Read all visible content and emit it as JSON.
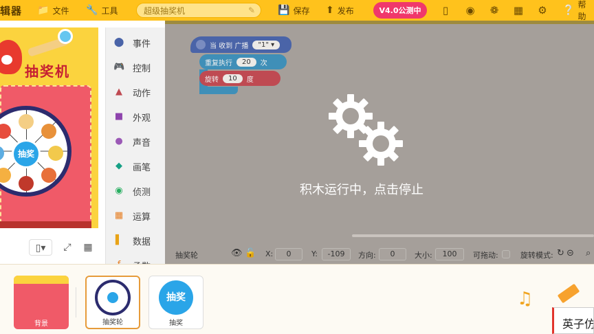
{
  "app": {
    "logo_text": "辑器",
    "menu": {
      "file": "文件",
      "tools": "工具"
    },
    "project_name": "超级抽奖机",
    "save": "保存",
    "publish": "发布",
    "version_badge": "V4.0公测中",
    "right_icons": [
      "phone-icon",
      "robot-icon",
      "extension-icon",
      "calendar-icon",
      "gear-icon"
    ],
    "help": "帮助",
    "accent_color": "#ffc21c",
    "badge_color": "#f0386b"
  },
  "stage": {
    "title": "抽奖机",
    "hub_label": "抽奖"
  },
  "categories": [
    {
      "label": "事件",
      "icon": "toggle-icon",
      "color": "#4a64a8"
    },
    {
      "label": "控制",
      "icon": "gamepad-icon",
      "color": "#3f8fb8"
    },
    {
      "label": "动作",
      "icon": "ghost-icon",
      "color": "#bf4a52"
    },
    {
      "label": "外观",
      "icon": "shirt-icon",
      "color": "#8e44ad"
    },
    {
      "label": "声音",
      "icon": "microphone-icon",
      "color": "#9b59b6"
    },
    {
      "label": "画笔",
      "icon": "brush-icon",
      "color": "#16a085"
    },
    {
      "label": "侦测",
      "icon": "radar-icon",
      "color": "#27ae60"
    },
    {
      "label": "运算",
      "icon": "calculator-icon",
      "color": "#e67e22"
    },
    {
      "label": "数据",
      "icon": "bar-chart-icon",
      "color": "#e8a317"
    },
    {
      "label": "函数",
      "icon": "function-icon",
      "color": "#e67e22"
    }
  ],
  "blocks": {
    "event": {
      "label": "当 收到 广播",
      "value": "\"1\""
    },
    "repeat": {
      "label": "重复执行",
      "value": "20",
      "unit": "次"
    },
    "rotate": {
      "label": "旋转",
      "value": "10",
      "unit": "度"
    }
  },
  "overlay": {
    "message": "积木运行中，点击停止"
  },
  "sprite_props": {
    "name": "抽奖轮",
    "x_label": "X:",
    "x_value": "0",
    "y_label": "Y:",
    "y_value": "-109",
    "direction_label": "方向:",
    "direction_value": "0",
    "size_label": "大小:",
    "size_value": "100",
    "draggable_label": "可拖动:",
    "rotation_label": "旋转模式:"
  },
  "tray": {
    "cards": [
      {
        "label": "背景",
        "thumb": "background-thumbnail"
      },
      {
        "label": "抽奖轮",
        "thumb": "wheel-thumbnail"
      },
      {
        "label": "抽奖",
        "thumb": "button-thumbnail"
      }
    ],
    "ime_text": "英子仿"
  }
}
